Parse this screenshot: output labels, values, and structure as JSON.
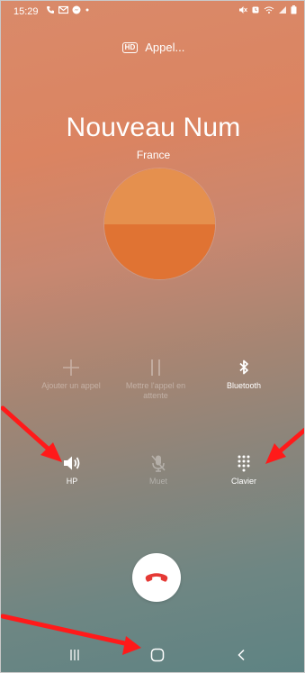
{
  "status_bar": {
    "time": "15:29",
    "right_icons": [
      "mute-icon",
      "alarm-icon",
      "wifi-calling-icon",
      "signal-icon",
      "battery-icon"
    ]
  },
  "call": {
    "hd_badge": "HD",
    "status": "Appel...",
    "contact_name": "Nouveau Num",
    "location": "France"
  },
  "actions": {
    "add_call": "Ajouter un appel",
    "hold": "Mettre l'appel en attente",
    "bluetooth": "Bluetooth",
    "speaker": "HP",
    "mute": "Muet",
    "keypad": "Clavier"
  },
  "colors": {
    "end_call_icon": "#e53935",
    "annotation_arrow": "#ff1a1a"
  }
}
